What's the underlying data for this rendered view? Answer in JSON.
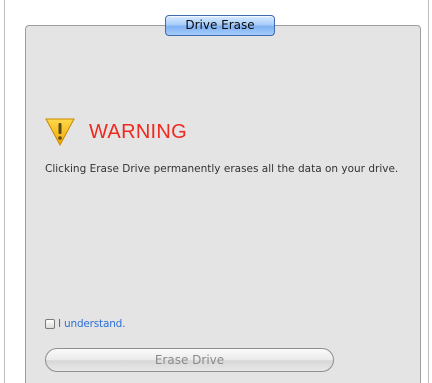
{
  "tab": {
    "label": "Drive Erase"
  },
  "warning": {
    "icon": "warning-triangle-icon",
    "title": "WARNING",
    "title_color": "#ee2a1f",
    "icon_color": "#f5b400"
  },
  "message": "Clicking Erase Drive permanently erases all the data on your drive.",
  "confirm": {
    "label": "I understand.",
    "checked": false
  },
  "erase_button": {
    "label": "Erase Drive",
    "enabled": false
  }
}
